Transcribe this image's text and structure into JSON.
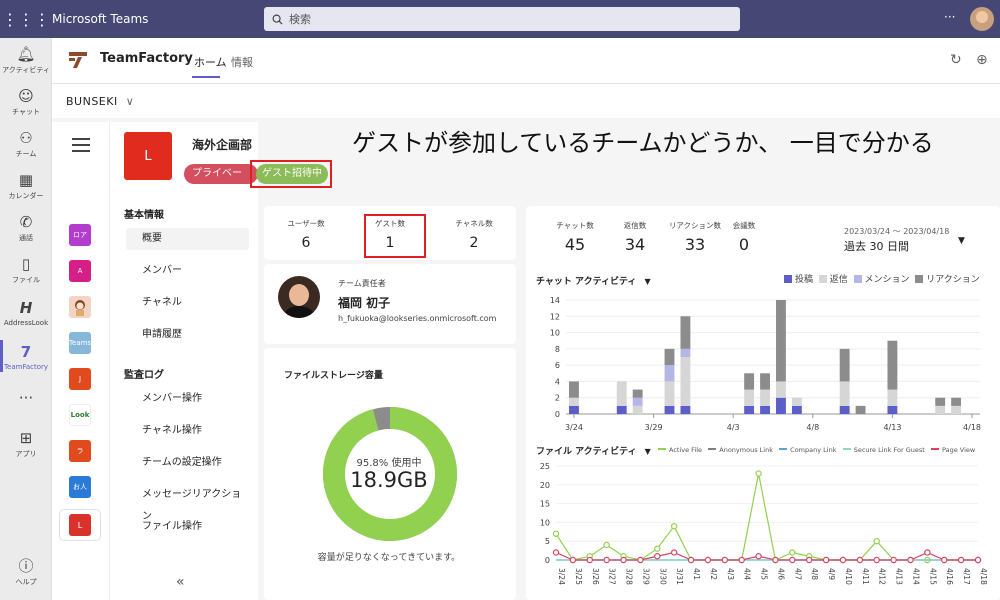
{
  "app": {
    "name": "Microsoft Teams",
    "search_placeholder": "検索",
    "more": "···"
  },
  "rail": [
    {
      "icon": "bell-icon",
      "glyph": "♫",
      "label": "アクティビティ"
    },
    {
      "icon": "chat-icon",
      "glyph": "◌",
      "label": "チャット"
    },
    {
      "icon": "teams-icon",
      "glyph": "⚇",
      "label": "チーム"
    },
    {
      "icon": "calendar-icon",
      "glyph": "▦",
      "label": "カレンダー"
    },
    {
      "icon": "phone-icon",
      "glyph": "✆",
      "label": "通話"
    },
    {
      "icon": "file-icon",
      "glyph": "▯",
      "label": "ファイル"
    },
    {
      "icon": "addresslook-icon",
      "glyph": "H",
      "label": "AddressLook"
    },
    {
      "icon": "teamfactory-icon",
      "glyph": "7",
      "label": "TeamFactory"
    },
    {
      "icon": "more-icon",
      "glyph": "···",
      "label": ""
    },
    {
      "icon": "apps-icon",
      "glyph": "⊞",
      "label": "アプリ"
    },
    {
      "icon": "help-icon",
      "glyph": "?",
      "label": "ヘルプ"
    }
  ],
  "header": {
    "title": "TeamFactory",
    "tabs": [
      "ホーム",
      "情報"
    ]
  },
  "team_select": {
    "value": "BUNSEKI"
  },
  "team_icons": [
    {
      "text": "ロア",
      "color": "#b23ccb"
    },
    {
      "text": "A",
      "color": "#d61f86"
    },
    {
      "text": "",
      "color": "#f3d4c4"
    },
    {
      "text": "Teams",
      "color": "#86b7d9"
    },
    {
      "text": "J",
      "color": "#e04a1d"
    },
    {
      "text": "Look",
      "color": "#ffffff"
    },
    {
      "text": "ラ",
      "color": "#e04a1d"
    },
    {
      "text": "お人",
      "color": "#2b7bd6"
    },
    {
      "text": "L",
      "color": "#d9322b"
    }
  ],
  "team": {
    "badge": "L",
    "name": "海外企画部",
    "privacy": "プライベート",
    "guest": "ゲスト招待中"
  },
  "nav": {
    "section1": "基本情報",
    "items1": [
      "概要",
      "メンバー",
      "チャネル",
      "申請履歴"
    ],
    "section2": "監査ログ",
    "items2": [
      "メンバー操作",
      "チャネル操作",
      "チームの設定操作",
      "メッセージリアクション",
      "ファイル操作"
    ],
    "collapse": "«"
  },
  "callout": "ゲストが参加しているチームかどうか、 一目で分かる",
  "stats": [
    {
      "label": "ユーザー数",
      "value": "6"
    },
    {
      "label": "ゲスト数",
      "value": "1"
    },
    {
      "label": "チャネル数",
      "value": "2"
    }
  ],
  "owner": {
    "label": "チーム責任者",
    "name": "福岡 初子",
    "email": "h_fukuoka@lookseries.onmicrosoft.com"
  },
  "storage": {
    "title": "ファイルストレージ容量",
    "percent": "95.8% 使用中",
    "used_fraction": 0.958,
    "value": "18.9GB",
    "note": "容量が足りなくなってきています。",
    "used_color": "#92d050",
    "free_color": "#8c8c8c"
  },
  "activity_stats": [
    {
      "label": "チャット数",
      "value": "45"
    },
    {
      "label": "返信数",
      "value": "34"
    },
    {
      "label": "リアクション数",
      "value": "33"
    },
    {
      "label": "会議数",
      "value": "0"
    }
  ],
  "date_range": "2023/03/24 ～ 2023/04/18",
  "period": "過去 30 日間",
  "chart_data": [
    {
      "type": "bar",
      "title": "チャット アクティビティ",
      "stacked": true,
      "categories": [
        "3/24",
        "3/25",
        "3/26",
        "3/27",
        "3/28",
        "3/29",
        "3/30",
        "3/31",
        "4/1",
        "4/2",
        "4/3",
        "4/4",
        "4/5",
        "4/6",
        "4/7",
        "4/8",
        "4/9",
        "4/10",
        "4/11",
        "4/12",
        "4/13",
        "4/14",
        "4/15",
        "4/16",
        "4/17",
        "4/18"
      ],
      "tick_labels": [
        "3/24",
        "3/29",
        "4/3",
        "4/8",
        "4/13",
        "4/18"
      ],
      "tick_index": [
        0,
        5,
        10,
        15,
        20,
        25
      ],
      "ylim": [
        0,
        14
      ],
      "yticks": [
        0,
        2,
        4,
        6,
        8,
        10,
        12,
        14
      ],
      "series": [
        {
          "name": "投稿",
          "color": "#5b5fc7",
          "values": [
            1,
            0,
            0,
            1,
            0,
            0,
            1,
            1,
            0,
            0,
            0,
            1,
            1,
            2,
            1,
            0,
            0,
            1,
            0,
            0,
            1,
            0,
            0,
            0,
            0,
            0
          ]
        },
        {
          "name": "返信",
          "color": "#d6d6d6",
          "values": [
            1,
            0,
            0,
            3,
            1,
            0,
            3,
            6,
            0,
            0,
            0,
            2,
            2,
            2,
            1,
            0,
            0,
            3,
            0,
            0,
            2,
            0,
            0,
            1,
            1,
            0
          ]
        },
        {
          "name": "メンション",
          "color": "#b4b6e6",
          "values": [
            0,
            0,
            0,
            0,
            1,
            0,
            2,
            1,
            0,
            0,
            0,
            0,
            0,
            0,
            0,
            0,
            0,
            0,
            0,
            0,
            0,
            0,
            0,
            0,
            0,
            0
          ]
        },
        {
          "name": "リアクション",
          "color": "#8c8c8c",
          "values": [
            2,
            0,
            0,
            0,
            1,
            0,
            2,
            4,
            0,
            0,
            0,
            2,
            2,
            10,
            0,
            0,
            0,
            4,
            1,
            0,
            6,
            0,
            0,
            1,
            1,
            0
          ]
        }
      ]
    },
    {
      "type": "line",
      "title": "ファイル アクティビティ",
      "x": [
        "3/24",
        "3/25",
        "3/26",
        "3/27",
        "3/28",
        "3/29",
        "3/30",
        "3/31",
        "4/1",
        "4/2",
        "4/3",
        "4/4",
        "4/5",
        "4/6",
        "4/7",
        "4/8",
        "4/9",
        "4/10",
        "4/11",
        "4/12",
        "4/13",
        "4/14",
        "4/15",
        "4/16",
        "4/17",
        "4/18"
      ],
      "ylim": [
        0,
        25
      ],
      "yticks": [
        0,
        5,
        10,
        15,
        20,
        25
      ],
      "series": [
        {
          "name": "Active File",
          "color": "#92d050",
          "values": [
            7,
            0,
            1,
            4,
            1,
            0,
            3,
            9,
            0,
            0,
            0,
            0,
            23,
            0,
            2,
            1,
            0,
            0,
            0,
            5,
            0,
            0,
            0,
            0,
            0,
            0
          ]
        },
        {
          "name": "Anonymous Link",
          "color": "#7f7f7f",
          "values": [
            0,
            0,
            0,
            0,
            0,
            0,
            0,
            0,
            0,
            0,
            0,
            0,
            0,
            0,
            0,
            0,
            0,
            0,
            0,
            0,
            0,
            0,
            0,
            0,
            0,
            0
          ]
        },
        {
          "name": "Company Link",
          "color": "#5ba3d9",
          "values": [
            0,
            0,
            0,
            0,
            0,
            0,
            0,
            0,
            0,
            0,
            0,
            0,
            0,
            0,
            0,
            0,
            0,
            0,
            0,
            0,
            0,
            0,
            0,
            0,
            0,
            0
          ]
        },
        {
          "name": "Secure Link For Guest",
          "color": "#8fd8d2",
          "values": [
            0,
            0,
            0,
            0,
            0,
            0,
            0,
            0,
            0,
            0,
            0,
            0,
            0,
            0,
            0,
            0,
            0,
            0,
            0,
            0,
            0,
            0,
            0,
            0,
            0,
            0
          ]
        },
        {
          "name": "Page View",
          "color": "#d9435f",
          "values": [
            2,
            0,
            0,
            0,
            0,
            0,
            1,
            2,
            0,
            0,
            0,
            0,
            1,
            0,
            0,
            0,
            0,
            0,
            0,
            0,
            0,
            0,
            2,
            0,
            0,
            0
          ]
        }
      ]
    }
  ]
}
